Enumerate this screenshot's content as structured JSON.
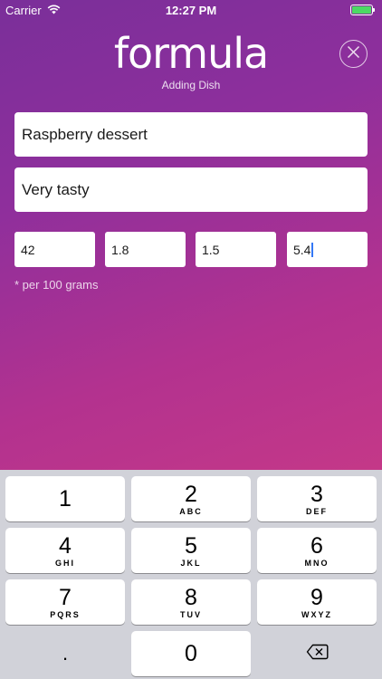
{
  "status_bar": {
    "carrier": "Carrier",
    "time": "12:27 PM"
  },
  "header": {
    "logo": "formula",
    "subtitle": "Adding Dish"
  },
  "icons": {
    "wifi": "wifi-icon",
    "battery": "battery-icon",
    "close": "close-icon",
    "backspace": "backspace-icon"
  },
  "colors": {
    "gradient_start": "#7a2f9a",
    "gradient_end": "#c43888",
    "battery": "#4cd964",
    "cursor": "#3478f6"
  },
  "form": {
    "dish_name": "Raspberry dessert",
    "description": "Very tasty",
    "values": [
      "42",
      "1.8",
      "1.5",
      "5.4"
    ],
    "note": "* per 100 grams"
  },
  "keypad": {
    "keys": [
      {
        "num": "1",
        "letters": ""
      },
      {
        "num": "2",
        "letters": "ABC"
      },
      {
        "num": "3",
        "letters": "DEF"
      },
      {
        "num": "4",
        "letters": "GHI"
      },
      {
        "num": "5",
        "letters": "JKL"
      },
      {
        "num": "6",
        "letters": "MNO"
      },
      {
        "num": "7",
        "letters": "PQRS"
      },
      {
        "num": "8",
        "letters": "TUV"
      },
      {
        "num": "9",
        "letters": "WXYZ"
      }
    ],
    "decimal": ".",
    "zero": "0"
  }
}
